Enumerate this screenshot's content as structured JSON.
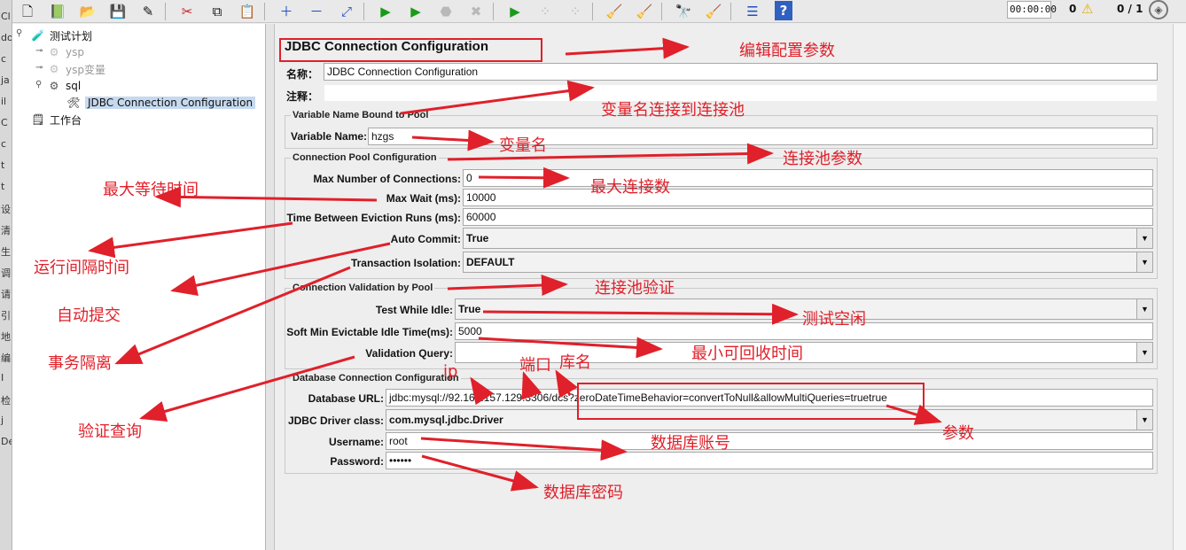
{
  "toolbar": {
    "timer": "00:00:00",
    "error_count": "0",
    "thread_count": "0 / 1",
    "icons": [
      "new-icon",
      "template-icon",
      "open-icon",
      "save-icon",
      "save-as-icon",
      "cut-icon",
      "copy-icon",
      "paste-icon",
      "expand-icon",
      "collapse-icon",
      "toggle-icon",
      "start-icon",
      "start-no-pause-icon",
      "stop-icon",
      "shutdown-icon",
      "remote-start-icon",
      "remote-stop-icon",
      "remote-exit-icon",
      "clear-icon",
      "clear-all-icon",
      "search-icon",
      "reset-search-icon",
      "function-helper-icon",
      "help-icon",
      "warning-icon",
      "remote-globe-icon"
    ]
  },
  "left_strip": [
    "Cl",
    "do",
    "c",
    "ja",
    "il",
    "C",
    "c",
    "t",
    "t",
    "设",
    "清",
    "生",
    "调",
    "请",
    "引",
    "地",
    "编",
    "I",
    "检",
    "j",
    "De"
  ],
  "tree": {
    "plan": "测试计划",
    "ysp": "ysp",
    "ysp_var": "ysp变量",
    "sql": "sql",
    "jdbc": "JDBC Connection Configuration",
    "workbench": "工作台"
  },
  "form": {
    "title": "JDBC Connection Configuration",
    "name_label": "名称：",
    "name_value": "JDBC Connection Configuration",
    "comment_label": "注释：",
    "comment_value": "",
    "var_group": "Variable Name Bound to Pool",
    "var_label": "Variable Name:",
    "var_value": "hzgs",
    "pool_group": "Connection Pool Configuration",
    "max_conn_label": "Max Number of Connections:",
    "max_conn_value": "0",
    "max_wait_label": "Max Wait (ms):",
    "max_wait_value": "10000",
    "eviction_label": "Time Between Eviction Runs (ms):",
    "eviction_value": "60000",
    "auto_commit_label": "Auto Commit:",
    "auto_commit_value": "True",
    "isolation_label": "Transaction Isolation:",
    "isolation_value": "DEFAULT",
    "validation_group": "Connection Validation by Pool",
    "test_idle_label": "Test While Idle:",
    "test_idle_value": "True",
    "soft_min_label": "Soft Min Evictable Idle Time(ms):",
    "soft_min_value": "5000",
    "val_query_label": "Validation Query:",
    "val_query_value": "",
    "db_group": "Database Connection Configuration",
    "url_label": "Database URL:",
    "url_value": "jdbc:mysql://92.168.157.129:3306/dcs?zeroDateTimeBehavior=convertToNull&allowMultiQueries=truetrue",
    "driver_label": "JDBC Driver class:",
    "driver_value": "com.mysql.jdbc.Driver",
    "username_label": "Username:",
    "username_value": "root",
    "password_label": "Password:",
    "password_value": "••••••"
  },
  "annotations": {
    "edit_config": "编辑配置参数",
    "var_pool": "变量名连接到连接池",
    "var_name": "变量名",
    "pool_params": "连接池参数",
    "max_wait": "最大等待时间",
    "max_conn": "最大连接数",
    "run_interval": "运行间隔时间",
    "auto_commit": "自动提交",
    "pool_validation": "连接池验证",
    "test_idle": "测试空闲",
    "min_evict": "最小可回收时间",
    "isolation": "事务隔离",
    "ip": "ip",
    "port": "端口",
    "db_name": "库名",
    "val_query": "验证查询",
    "params": "参数",
    "db_account": "数据库账号",
    "db_password": "数据库密码"
  },
  "colors": {
    "annotation": "#e0202a",
    "selection": "#c5d9ef"
  }
}
